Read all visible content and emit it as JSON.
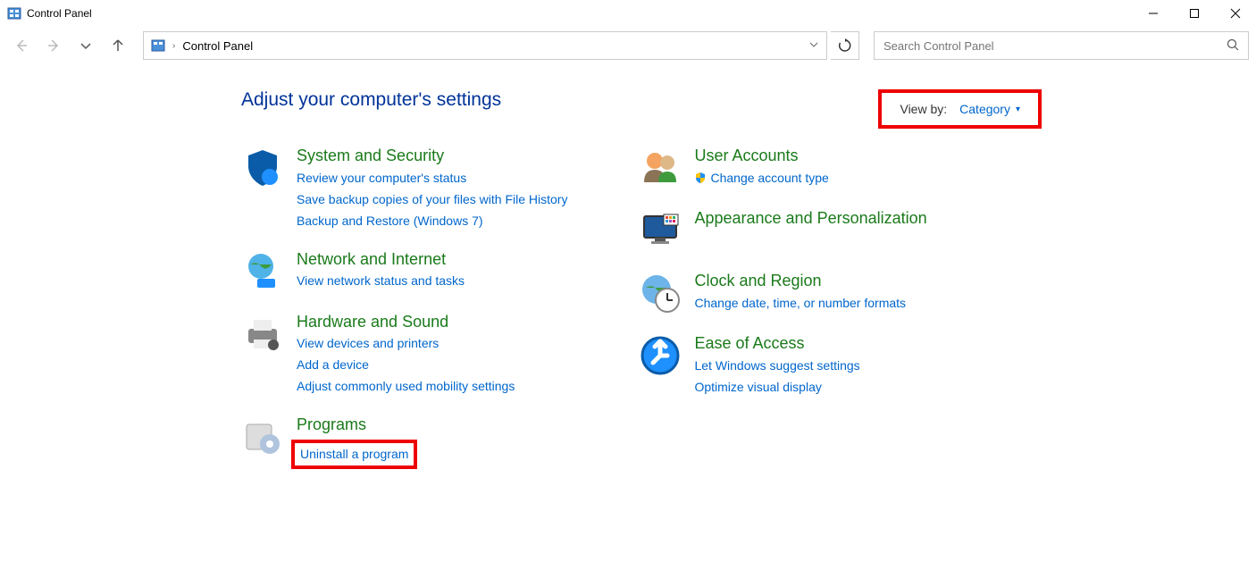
{
  "window": {
    "title": "Control Panel"
  },
  "addressbar": {
    "path": "Control Panel"
  },
  "search": {
    "placeholder": "Search Control Panel"
  },
  "page": {
    "title": "Adjust your computer's settings"
  },
  "viewby": {
    "label": "View by:",
    "value": "Category"
  },
  "categories": {
    "left": [
      {
        "title": "System and Security",
        "links": [
          "Review your computer's status",
          "Save backup copies of your files with File History",
          "Backup and Restore (Windows 7)"
        ]
      },
      {
        "title": "Network and Internet",
        "links": [
          "View network status and tasks"
        ]
      },
      {
        "title": "Hardware and Sound",
        "links": [
          "View devices and printers",
          "Add a device",
          "Adjust commonly used mobility settings"
        ]
      },
      {
        "title": "Programs",
        "links": [
          "Uninstall a program"
        ]
      }
    ],
    "right": [
      {
        "title": "User Accounts",
        "links": [
          "Change account type"
        ],
        "shield": true
      },
      {
        "title": "Appearance and Personalization",
        "links": []
      },
      {
        "title": "Clock and Region",
        "links": [
          "Change date, time, or number formats"
        ]
      },
      {
        "title": "Ease of Access",
        "links": [
          "Let Windows suggest settings",
          "Optimize visual display"
        ]
      }
    ]
  }
}
